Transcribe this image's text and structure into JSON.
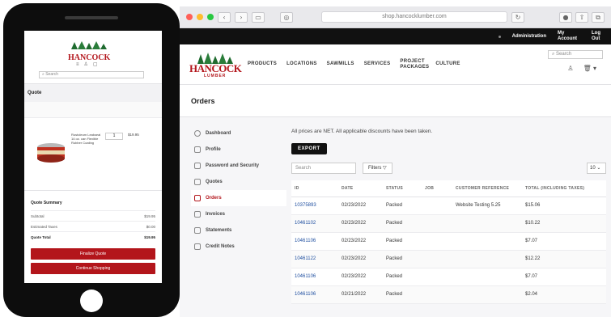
{
  "browser": {
    "url": "shop.hancocklumber.com",
    "traffic_light_colors": [
      "#ff5f57",
      "#febc2e",
      "#28c840"
    ]
  },
  "utility_bar": {
    "items": [
      "Administration",
      "My Account",
      "Log Out"
    ]
  },
  "header": {
    "logo_text": "HANCOCK",
    "logo_sub": "LUMBER",
    "nav": [
      "PRODUCTS",
      "LOCATIONS",
      "SAWMILLS",
      "SERVICES",
      "PROJECT PACKAGES",
      "CULTURE"
    ],
    "search_placeholder": "Search"
  },
  "page": {
    "title": "Orders"
  },
  "sidebar": {
    "items": [
      {
        "label": "Dashboard",
        "icon": "dashboard-icon"
      },
      {
        "label": "Profile",
        "icon": "profile-icon"
      },
      {
        "label": "Password and Security",
        "icon": "key-icon"
      },
      {
        "label": "Quotes",
        "icon": "quote-icon"
      },
      {
        "label": "Orders",
        "icon": "orders-icon",
        "active": true
      },
      {
        "label": "Invoices",
        "icon": "invoice-icon"
      },
      {
        "label": "Statements",
        "icon": "statement-icon"
      },
      {
        "label": "Credit Notes",
        "icon": "credit-note-icon"
      }
    ]
  },
  "orders": {
    "notice": "All prices are NET. All applicable discounts have been taken.",
    "export_label": "EXPORT",
    "search_placeholder": "Search",
    "filters_label": "Filters",
    "per_page": "10",
    "columns": [
      "ID",
      "DATE",
      "STATUS",
      "JOB",
      "CUSTOMER REFERENCE",
      "TOTAL (INCLUDING TAXES)"
    ],
    "rows": [
      [
        "10375893",
        "02/23/2022",
        "Packed",
        "",
        "Website Testing 5.25",
        "$15.06"
      ],
      [
        "10461102",
        "02/23/2022",
        "Packed",
        "",
        "",
        "$10.22"
      ],
      [
        "10461106",
        "02/23/2022",
        "Packed",
        "",
        "",
        "$7.07"
      ],
      [
        "10461122",
        "02/23/2022",
        "Packed",
        "",
        "",
        "$12.22"
      ],
      [
        "10461106",
        "02/23/2022",
        "Packed",
        "",
        "",
        "$7.07"
      ],
      [
        "10461106",
        "02/21/2022",
        "Packed",
        "",
        "",
        "$2.04"
      ]
    ]
  },
  "mobile": {
    "logo_text": "HANCOCK",
    "search_placeholder": "Search",
    "section_title": "Quote",
    "item_text": "Rustoleum Leakseal 14 oz. can Flexible Rubber Coating",
    "item_qty": "1",
    "item_price": "$19.95",
    "summary_title": "Quote Summary",
    "summary_rows": [
      {
        "label": "Subtotal",
        "value": "$19.95"
      },
      {
        "label": "Estimated Taxes",
        "value": "$0.00"
      },
      {
        "label": "Quote Total",
        "value": "$19.95"
      }
    ],
    "buttons": [
      "Finalize Quote",
      "Continue Shopping"
    ]
  }
}
